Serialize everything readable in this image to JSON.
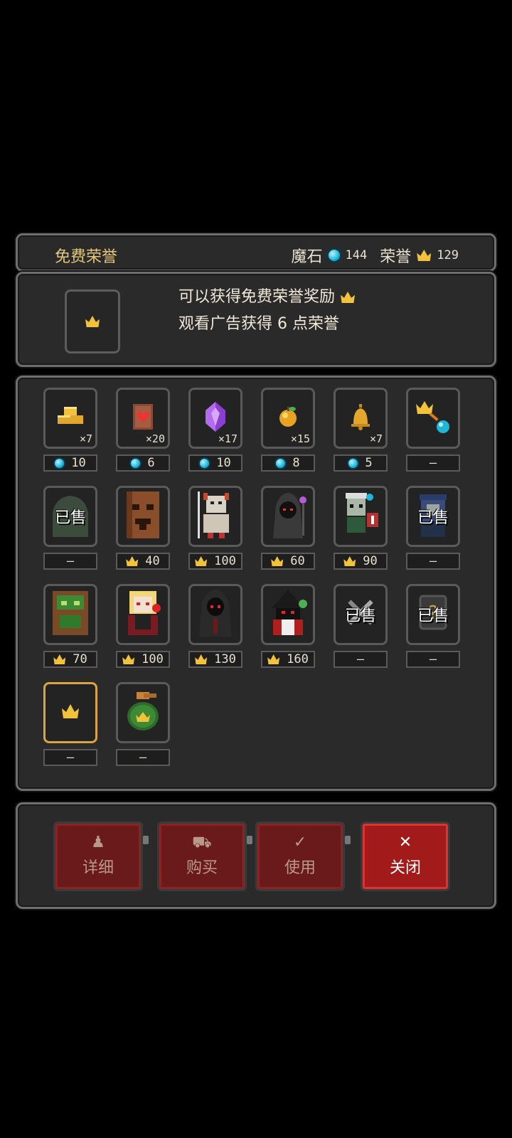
{
  "header": {
    "title": "免费荣誉",
    "magic_stone_label": "魔石",
    "magic_stone_value": "144",
    "honor_label": "荣誉",
    "honor_value": "129"
  },
  "ad_panel": {
    "line1": "可以获得免费荣誉奖励",
    "line2": "观看广告获得 6 点荣誉"
  },
  "items": [
    {
      "name": "gold-ingots-icon",
      "count": "×7",
      "price_type": "gem",
      "price": "10",
      "sold": ""
    },
    {
      "name": "heart-scroll-icon",
      "count": "×20",
      "price_type": "gem",
      "price": "6",
      "sold": ""
    },
    {
      "name": "purple-crystal-icon",
      "count": "×17",
      "price_type": "gem",
      "price": "10",
      "sold": ""
    },
    {
      "name": "golden-apple-icon",
      "count": "×15",
      "price_type": "gem",
      "price": "8",
      "sold": ""
    },
    {
      "name": "golden-bell-icon",
      "count": "×7",
      "price_type": "gem",
      "price": "5",
      "sold": ""
    },
    {
      "name": "crown-to-gem-icon",
      "count": "",
      "price_type": "none",
      "price": "—",
      "sold": ""
    },
    {
      "name": "green-slime-icon",
      "count": "",
      "price_type": "none",
      "price": "—",
      "sold": "已售"
    },
    {
      "name": "tree-golem-icon",
      "count": "",
      "price_type": "crown",
      "price": "40",
      "sold": ""
    },
    {
      "name": "horned-knight-icon",
      "count": "",
      "price_type": "crown",
      "price": "100",
      "sold": ""
    },
    {
      "name": "hooded-shadow-icon",
      "count": "",
      "price_type": "crown",
      "price": "60",
      "sold": ""
    },
    {
      "name": "zombie-banner-icon",
      "count": "",
      "price_type": "crown",
      "price": "90",
      "sold": ""
    },
    {
      "name": "blue-witch-icon",
      "count": "",
      "price_type": "none",
      "price": "—",
      "sold": "已售"
    },
    {
      "name": "green-treant-icon",
      "count": "",
      "price_type": "crown",
      "price": "70",
      "sold": ""
    },
    {
      "name": "blonde-vampire-icon",
      "count": "",
      "price_type": "crown",
      "price": "100",
      "sold": ""
    },
    {
      "name": "red-eyed-reaper-icon",
      "count": "",
      "price_type": "crown",
      "price": "130",
      "sold": ""
    },
    {
      "name": "dark-mage-icon",
      "count": "",
      "price_type": "crown",
      "price": "160",
      "sold": ""
    },
    {
      "name": "crossed-swords-icon",
      "count": "",
      "price_type": "none",
      "price": "—",
      "sold": "已售"
    },
    {
      "name": "mystery-question-icon",
      "count": "",
      "price_type": "none",
      "price": "—",
      "sold": "已售"
    },
    {
      "name": "crown-icon",
      "count": "",
      "price_type": "none",
      "price": "—",
      "sold": ""
    },
    {
      "name": "crown-bag-icon",
      "count": "",
      "price_type": "none",
      "price": "—",
      "sold": ""
    }
  ],
  "buttons": {
    "detail": "详细",
    "buy": "购买",
    "use": "使用",
    "close": "关闭"
  },
  "colors": {
    "accent_gold": "#e6c77a",
    "button_red": "#a31a1a",
    "gem_blue": "#1fb6d8"
  }
}
